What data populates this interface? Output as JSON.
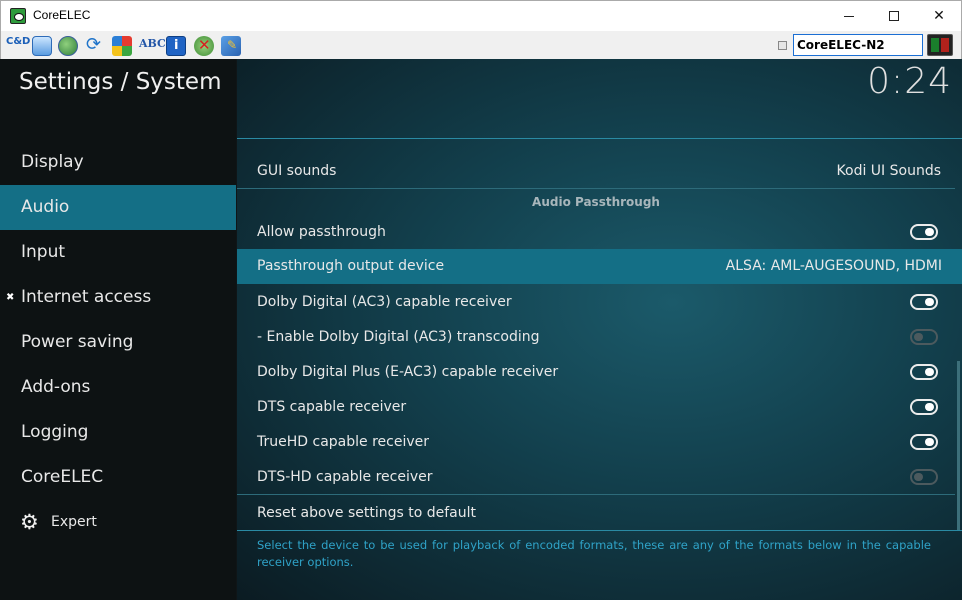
{
  "window": {
    "title": "CoreELEC",
    "minimize_symbol": "",
    "maximize_symbol": "",
    "close_symbol": "✕"
  },
  "toolbar": {
    "icons": [
      "connect-icon",
      "window-icon",
      "globe-icon",
      "refresh-icon",
      "windows-icon",
      "abc-icon",
      "info-icon",
      "remote-icon",
      "settings-icon"
    ],
    "host": "CoreELEC-N2"
  },
  "kodi": {
    "page_title": "Settings / System",
    "clock": "0:24",
    "nav": {
      "items": [
        "Display",
        "Audio",
        "Input",
        "Internet access",
        "Power saving",
        "Add-ons",
        "Logging",
        "CoreELEC"
      ],
      "active": "Audio",
      "level_label": "Expert"
    },
    "settings": {
      "gui_sounds": {
        "label": "GUI sounds",
        "value": "Kodi UI Sounds"
      },
      "section_header": "Audio Passthrough",
      "rows": [
        {
          "label": "Allow passthrough",
          "toggle": "on"
        },
        {
          "label": "Passthrough output device",
          "value": "ALSA: AML-AUGESOUND, HDMI",
          "focused": true
        },
        {
          "label": "Dolby Digital (AC3) capable receiver",
          "toggle": "on"
        },
        {
          "label": "- Enable Dolby Digital (AC3) transcoding",
          "toggle": "off"
        },
        {
          "label": "Dolby Digital Plus (E-AC3) capable receiver",
          "toggle": "on"
        },
        {
          "label": "DTS capable receiver",
          "toggle": "on"
        },
        {
          "label": "TrueHD capable receiver",
          "toggle": "on"
        },
        {
          "label": "DTS-HD capable receiver",
          "toggle": "off"
        }
      ],
      "reset_label": "Reset above settings to default",
      "help_text": "Select the device to be used for playback of encoded formats, these are any of the formats below in the capable receiver options."
    }
  }
}
